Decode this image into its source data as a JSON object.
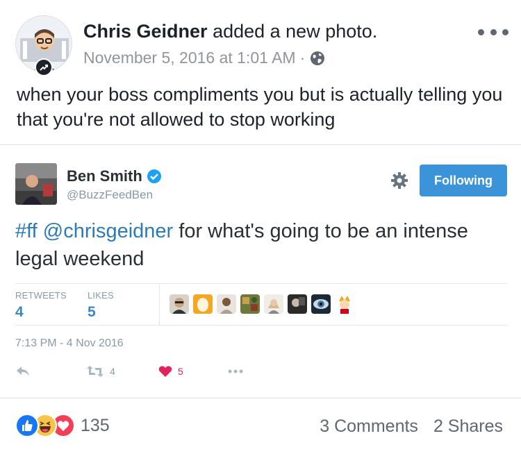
{
  "post": {
    "author_name": "Chris Geidner",
    "action": "added a new photo.",
    "timestamp": "November 5, 2016 at 1:01 AM",
    "separator": "·",
    "privacy_icon": "globe-icon",
    "menu_icon": "more-horizontal-icon",
    "text": "when your boss compliments you but is actually telling you that you're not allowed to stop working"
  },
  "tweet": {
    "name": "Ben Smith",
    "handle": "@BuzzFeedBen",
    "follow_label": "Following",
    "text_hashtag": "#ff",
    "text_mention": "@chrisgeidner",
    "text_rest": " for what's going to be an intense legal weekend",
    "retweets_label": "RETWEETS",
    "retweets_value": "4",
    "likes_label": "LIKES",
    "likes_value": "5",
    "time": "7:13 PM - 4 Nov 2016",
    "action_retweet_count": "4",
    "action_like_count": "5",
    "colors": {
      "link": "#2b7bb9",
      "follow_bg": "#3b94d9",
      "like_red": "#e0245e"
    }
  },
  "reactions": {
    "icons": [
      "like-reaction-icon",
      "haha-reaction-icon",
      "love-reaction-icon"
    ],
    "count": "135",
    "comments": "3 Comments",
    "shares": "2 Shares"
  }
}
